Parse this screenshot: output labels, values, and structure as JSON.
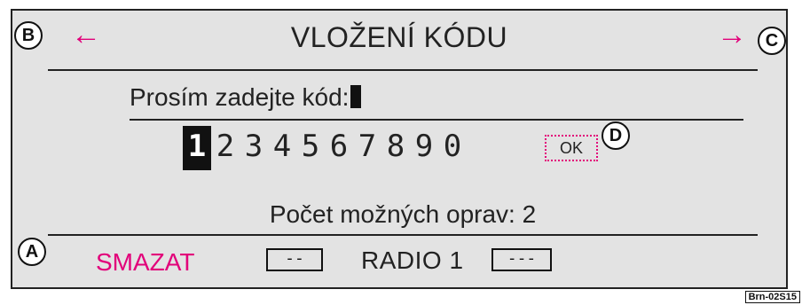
{
  "header": {
    "title": "VLOŽENÍ KÓDU",
    "left_arrow": "←",
    "right_arrow": "→",
    "left_callout": "B",
    "right_callout": "C"
  },
  "main": {
    "prompt": "Prosím zadejte kód:",
    "digits": [
      "1",
      "2",
      "3",
      "4",
      "5",
      "6",
      "7",
      "8",
      "9",
      "0"
    ],
    "selected_digit": "1",
    "ok_label": "OK",
    "ok_callout": "D",
    "corrections_text": "Počet možných oprav: 2"
  },
  "footer": {
    "delete_label": "SMAZAT",
    "delete_callout": "A",
    "left_box": "--",
    "source_label": "RADIO 1",
    "right_box": "---"
  },
  "figure_code": "Brn-02S15",
  "colors": {
    "accent": "#e2007a",
    "screen_bg": "#e3e3e3",
    "text": "#222222"
  }
}
